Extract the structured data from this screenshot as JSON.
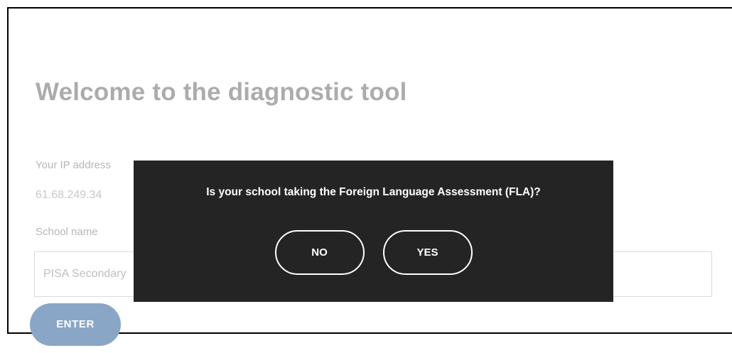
{
  "page": {
    "title": "Welcome to the diagnostic tool",
    "ip_label": "Your IP address",
    "ip_value": "61.68.249.34",
    "school_label": "School name",
    "school_input_value": "PISA Secondary",
    "enter_label": "ENTER"
  },
  "modal": {
    "question": "Is your school taking the Foreign Language Assessment (FLA)?",
    "no_label": "NO",
    "yes_label": "YES"
  },
  "colors": {
    "modal_background": "#242424",
    "enter_button": "#8aa6c6",
    "frame_border": "#000000"
  }
}
